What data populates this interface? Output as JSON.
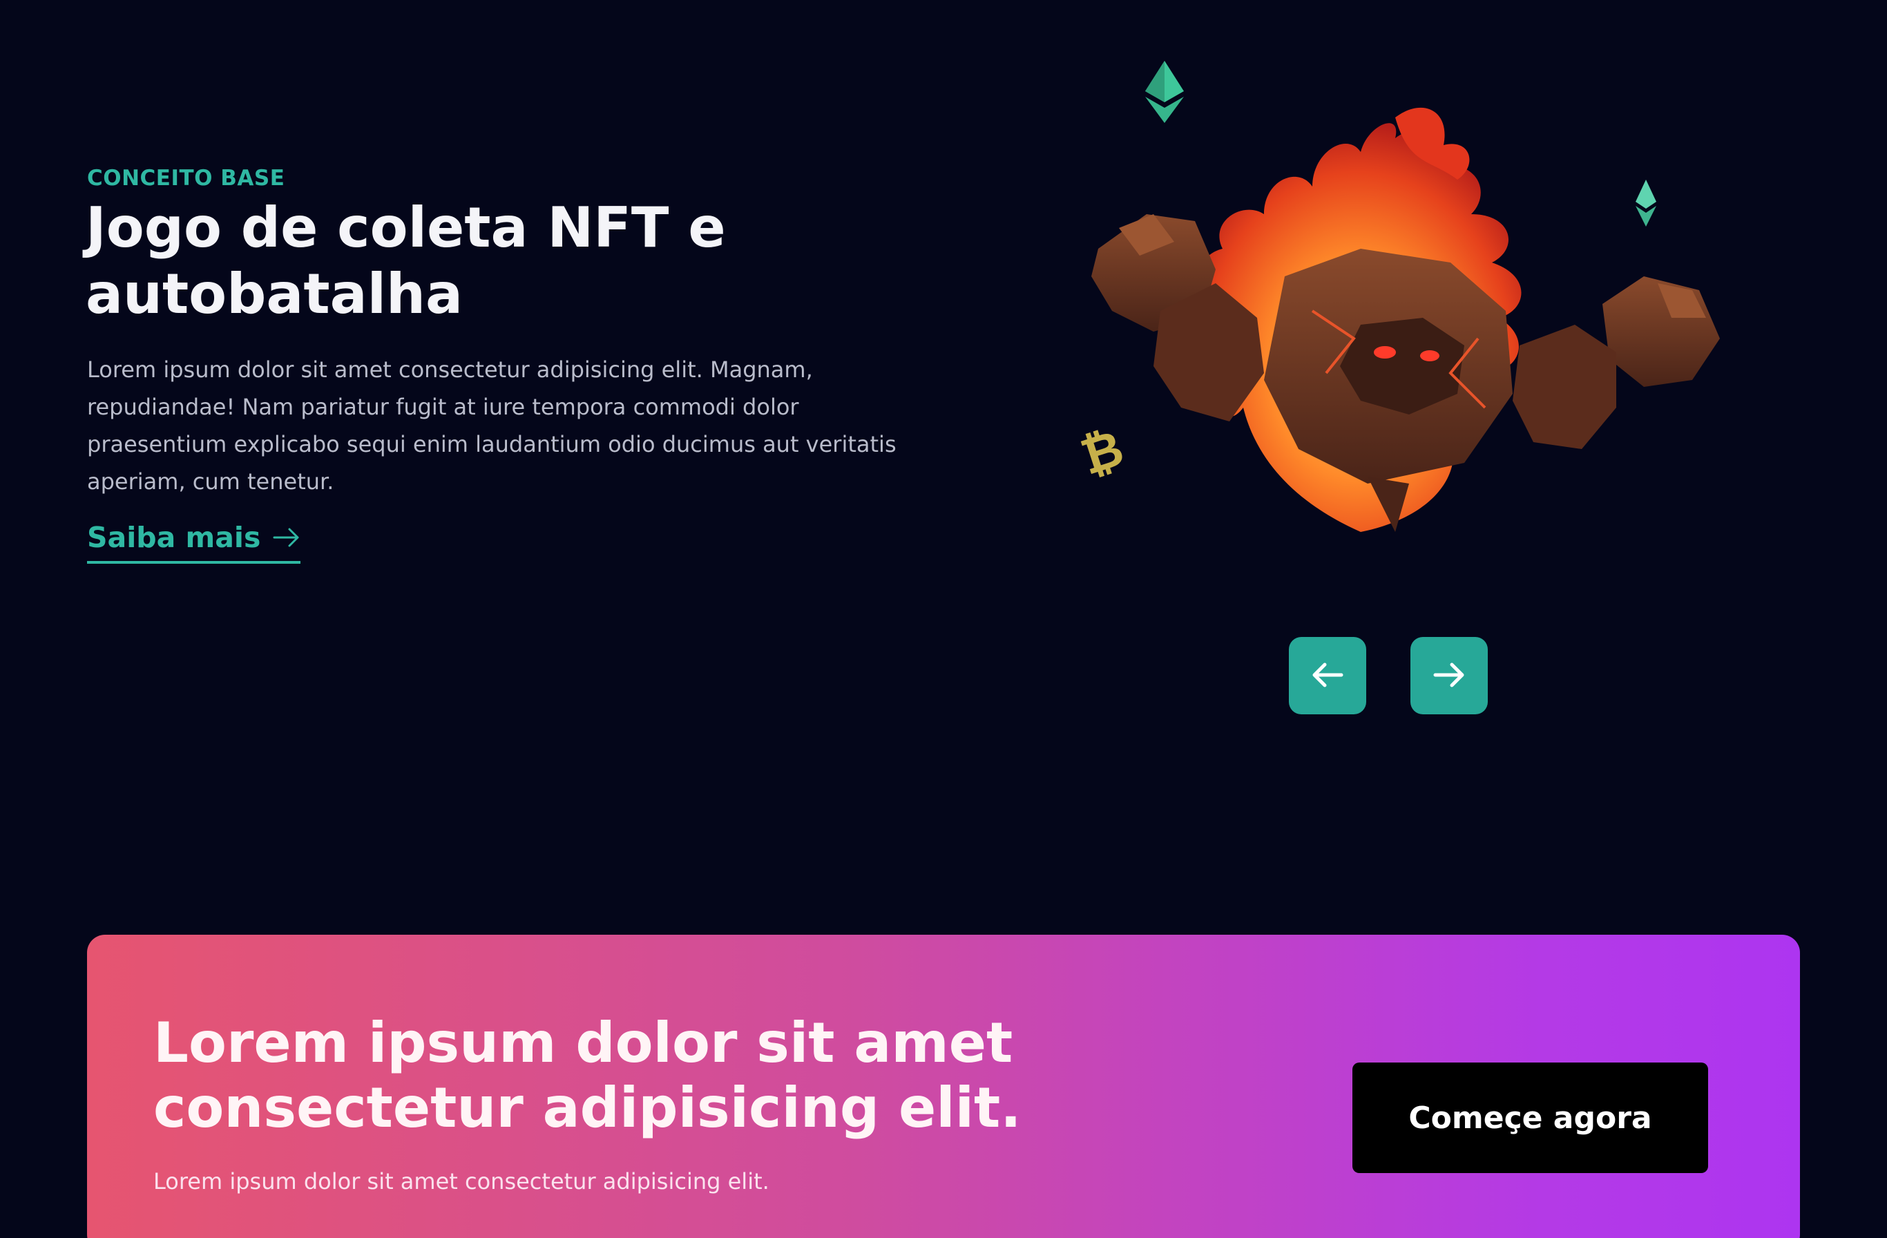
{
  "hero": {
    "eyebrow": "CONCEITO BASE",
    "title": "Jogo de coleta NFT e autobatalha",
    "description": "Lorem ipsum dolor sit amet consectetur adipisicing elit. Magnam, repudiandae! Nam pariatur fugit at iure tempora commodi dolor praesentium explicabo sequi enim laudantium odio ducimus aut veritatis aperiam, cum tenetur.",
    "link_label": "Saiba mais",
    "link_icon": "arrow-right-icon",
    "art": {
      "character": "fire-rock-golem",
      "decorations": [
        "ethereum-icon",
        "ethereum-icon",
        "bitcoin-icon"
      ]
    }
  },
  "slider": {
    "prev_icon": "arrow-left-icon",
    "next_icon": "arrow-right-icon"
  },
  "cta": {
    "title": "Lorem ipsum dolor sit amet consectetur adipisicing elit.",
    "subtitle": "Lorem ipsum dolor sit amet consectetur adipisicing elit.",
    "button_label": "Começe agora"
  },
  "colors": {
    "background": "#04061a",
    "accent": "#2fb8a3",
    "button_teal": "#27a898",
    "gradient_start": "#e65570",
    "gradient_end": "#ad35f0",
    "cta_button": "#000000"
  }
}
